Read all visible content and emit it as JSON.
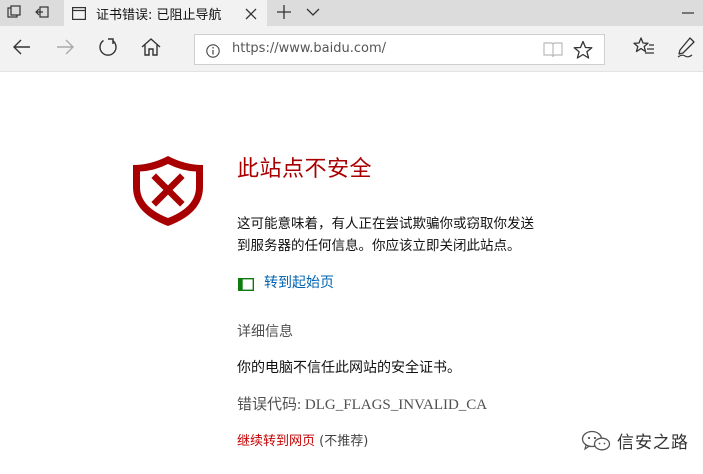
{
  "tab": {
    "title": "证书错误: 已阻止导航"
  },
  "address_bar": {
    "url": "https://www.baidu.com/"
  },
  "error_page": {
    "title": "此站点不安全",
    "body_line1": "这可能意味着，有人正在尝试欺骗你或窃取你发送",
    "body_line2": "到服务器的任何信息。你应该立即关闭此站点。",
    "goto_start_label": "转到起始页",
    "details_heading": "详细信息",
    "details_text": "你的电脑不信任此网站的安全证书。",
    "error_code": "错误代码: DLG_FLAGS_INVALID_CA",
    "continue_label": "继续转到网页",
    "continue_note": "(不推荐)"
  },
  "watermark": {
    "text": "信安之路"
  },
  "colors": {
    "danger": "#a80000",
    "link": "#0063b1",
    "continue": "#c40000",
    "goto_icon": "#107c10"
  },
  "icons": {
    "tab_manager": "tab-manager-icon",
    "set_aside": "set-aside-tabs-icon",
    "page": "page-icon",
    "close": "close-icon",
    "new_tab": "plus-icon",
    "tab_list": "chevron-down-icon",
    "minimize": "minimize-icon",
    "back": "back-arrow-icon",
    "forward": "forward-arrow-icon",
    "refresh": "refresh-icon",
    "home": "home-icon",
    "info": "info-icon",
    "reading_view": "reading-view-icon",
    "favorite": "star-icon",
    "favorites_hub": "favorites-hub-icon",
    "notes": "pen-icon",
    "shield": "shield-x-icon",
    "start_page": "window-icon",
    "wechat": "wechat-logo-icon"
  }
}
